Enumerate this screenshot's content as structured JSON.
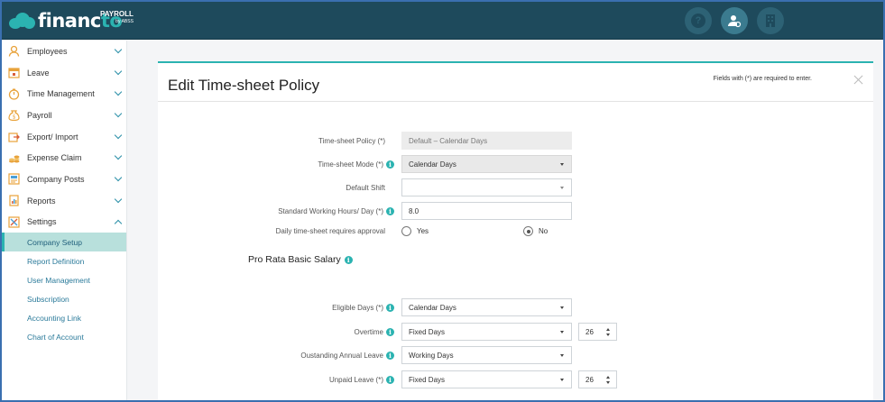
{
  "brand": {
    "name_main": "financ",
    "name_accent": "to",
    "product": "PAYROLL",
    "by": "by ABSS"
  },
  "top_icons": [
    "help-icon",
    "user-settings-icon",
    "building-icon"
  ],
  "sidebar": {
    "items": [
      {
        "label": "Employees",
        "icon": "employee-icon",
        "expanded": false
      },
      {
        "label": "Leave",
        "icon": "calendar-icon",
        "expanded": false
      },
      {
        "label": "Time Management",
        "icon": "stopwatch-icon",
        "expanded": false
      },
      {
        "label": "Payroll",
        "icon": "money-bag-icon",
        "expanded": false
      },
      {
        "label": "Export/ Import",
        "icon": "export-icon",
        "expanded": false
      },
      {
        "label": "Expense Claim",
        "icon": "coins-icon",
        "expanded": false
      },
      {
        "label": "Company Posts",
        "icon": "posts-icon",
        "expanded": false
      },
      {
        "label": "Reports",
        "icon": "report-icon",
        "expanded": false
      },
      {
        "label": "Settings",
        "icon": "settings-icon",
        "expanded": true
      }
    ],
    "subitems": [
      {
        "label": "Company Setup",
        "active": true
      },
      {
        "label": "Report Definition",
        "active": false
      },
      {
        "label": "User Management",
        "active": false
      },
      {
        "label": "Subscription",
        "active": false
      },
      {
        "label": "Accounting Link",
        "active": false
      },
      {
        "label": "Chart of Account",
        "active": false
      }
    ]
  },
  "form": {
    "title": "Edit Time-sheet Policy",
    "required_note": "Fields with (*) are required to enter.",
    "policy_label": "Time-sheet Policy (*)",
    "policy_value": "Default – Calendar Days",
    "mode_label": "Time-sheet Mode (*)",
    "mode_value": "Calendar Days",
    "shift_label": "Default Shift",
    "shift_value": "",
    "hours_label": "Standard Working Hours/ Day (*)",
    "hours_value": "8.0",
    "approval_label": "Daily time-sheet requires approval",
    "approval_yes": "Yes",
    "approval_no": "No",
    "approval_selected": "No",
    "section_title": "Pro Rata Basic Salary",
    "eligible_label": "Eligible Days (*)",
    "eligible_value": "Calendar Days",
    "overtime_label": "Overtime",
    "overtime_value": "Fixed Days",
    "overtime_days": "26",
    "leave_label": "Oustanding Annual Leave",
    "leave_value": "Working Days",
    "unpaid_label": "Unpaid Leave (*)",
    "unpaid_value": "Fixed Days",
    "unpaid_days": "26"
  },
  "colors": {
    "topbar": "#1e4a5c",
    "accent": "#2bb3b1",
    "link": "#2a7a9a"
  }
}
